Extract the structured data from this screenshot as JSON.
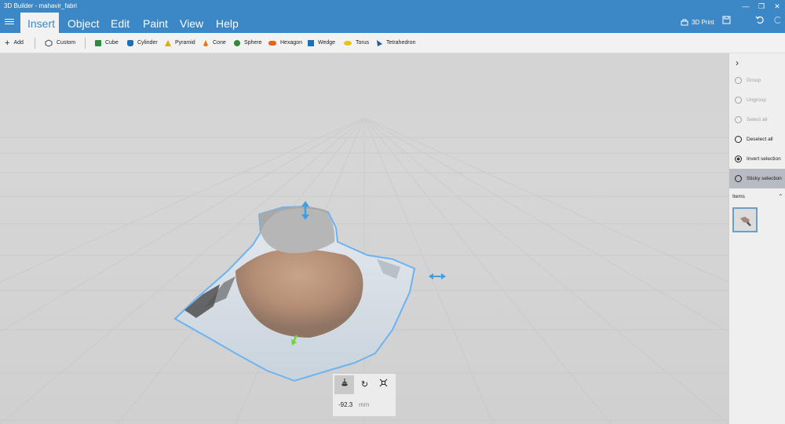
{
  "window": {
    "title": "3D Builder - mahavir_fabri",
    "buttons": {
      "minimize": "—",
      "restore": "❐",
      "close": "✕"
    }
  },
  "menu": {
    "items": [
      "Insert",
      "Object",
      "Edit",
      "Paint",
      "View",
      "Help"
    ],
    "active": "Insert",
    "print_label": "3D Print"
  },
  "toolbar": {
    "add_label": "Add",
    "custom_label": "Custom",
    "shapes": [
      {
        "label": "Cube",
        "color": "#2e8b3e",
        "icon": "cube-icon"
      },
      {
        "label": "Cylinder",
        "color": "#1e6fb5",
        "icon": "cylinder-icon"
      },
      {
        "label": "Pyramid",
        "color": "#d8b00e",
        "icon": "pyramid-icon"
      },
      {
        "label": "Cone",
        "color": "#e0761f",
        "icon": "cone-icon"
      },
      {
        "label": "Sphere",
        "color": "#2f8a3a",
        "icon": "sphere-icon"
      },
      {
        "label": "Hexagon",
        "color": "#e0651f",
        "icon": "hexagon-icon"
      },
      {
        "label": "Wedge",
        "color": "#1f6fb8",
        "icon": "wedge-icon"
      },
      {
        "label": "Torus",
        "color": "#e3c514",
        "icon": "torus-icon"
      },
      {
        "label": "Tetrahedron",
        "color": "#1f5f9e",
        "icon": "tetrahedron-icon"
      }
    ]
  },
  "panel": {
    "actions": [
      {
        "label": "Group",
        "enabled": false
      },
      {
        "label": "Ungroup",
        "enabled": false
      },
      {
        "label": "Select all",
        "enabled": false
      },
      {
        "label": "Deselect all",
        "enabled": true
      },
      {
        "label": "Invert selection",
        "enabled": true
      },
      {
        "label": "Sticky selection",
        "enabled": true,
        "selected": true
      }
    ],
    "items_label": "Items"
  },
  "transform": {
    "value": "-92.3",
    "unit": "mm"
  },
  "colors": {
    "accent": "#3c87c5",
    "selection_outline": "#6db3f0",
    "gizmo_blue": "#3aa0e8",
    "gizmo_green": "#6fd63a"
  }
}
